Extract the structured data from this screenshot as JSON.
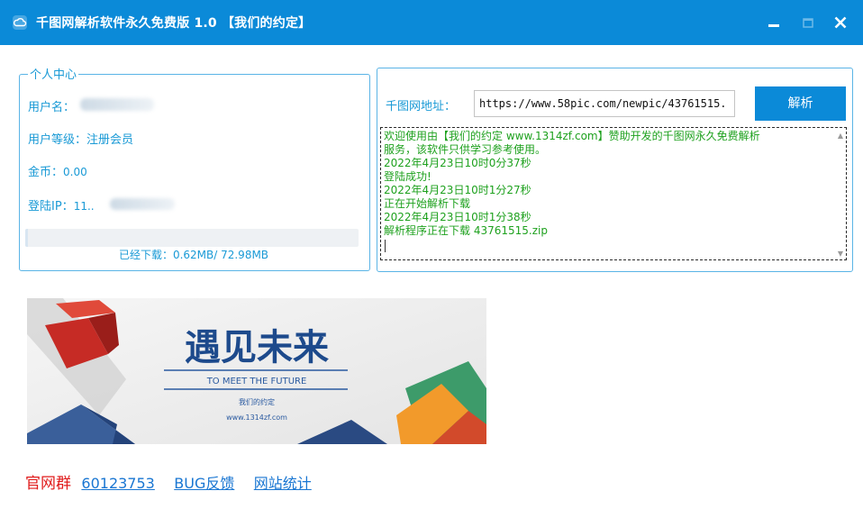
{
  "window": {
    "title": "千图网解析软件永久免费版 1.0 【我们的约定】",
    "minimize_label": "minimize",
    "maximize_label": "maximize",
    "close_label": "close"
  },
  "user_panel": {
    "legend": "个人中心",
    "username_label": "用户名：",
    "username_value": "",
    "level_label": "用户等级：",
    "level_value": "注册会员",
    "coins_label": "金币：",
    "coins_value": "0.00",
    "ip_label": "登陆IP：",
    "ip_value": "11..",
    "progress_fraction": 0.0085,
    "downloaded_text": "已经下载：0.62MB/ 72.98MB"
  },
  "parse_panel": {
    "url_label": "千图网地址：",
    "url_value": "https://www.58pic.com/newpic/43761515.",
    "parse_button": "解析",
    "log_lines": [
      "欢迎使用由【我们的约定 www.1314zf.com】赞助开发的千图网永久免费解析",
      "服务，该软件只供学习参考使用。",
      "2022年4月23日10时0分37秒",
      "登陆成功!",
      "2022年4月23日10时1分27秒",
      "正在开始解析下载",
      "2022年4月23日10时1分38秒",
      "解析程序正在下载 43761515.zip"
    ]
  },
  "banner": {
    "headline": "遇见未来",
    "subline": "TO MEET THE FUTURE",
    "brand": "我们的约定",
    "site": "www.1314zf.com"
  },
  "footer": {
    "group_label": "官网群",
    "group_number": "60123753",
    "bug_link": "BUG反馈",
    "stats_link": "网站统计"
  },
  "colors": {
    "titlebar": "#0b8ad8",
    "accent_text": "#1a9ad6",
    "log_text": "#1ea11e",
    "footer_red": "#e01b1b",
    "link_blue": "#1976d2"
  }
}
